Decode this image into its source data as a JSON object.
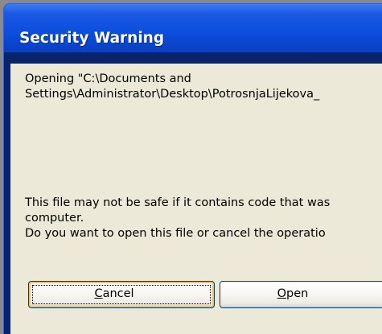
{
  "dialog": {
    "title": "Security Warning",
    "message_lines": [
      "Opening \"C:\\Documents and",
      "Settings\\Administrator\\Desktop\\PotrosnjaLijekova_"
    ],
    "warning_lines": [
      "This file may not be safe if it contains code that was",
      "computer.",
      "Do you want to open this file or cancel the operatio"
    ]
  },
  "buttons": {
    "cancel": {
      "mnemonic": "C",
      "rest": "ancel"
    },
    "open": {
      "mnemonic": "O",
      "rest": "pen"
    }
  },
  "colors": {
    "title_bar": "#0d4fdd",
    "client_background": "#ece9d8",
    "desktop_background": "#8a8a8a",
    "focus_highlight": "#f3c06a"
  }
}
